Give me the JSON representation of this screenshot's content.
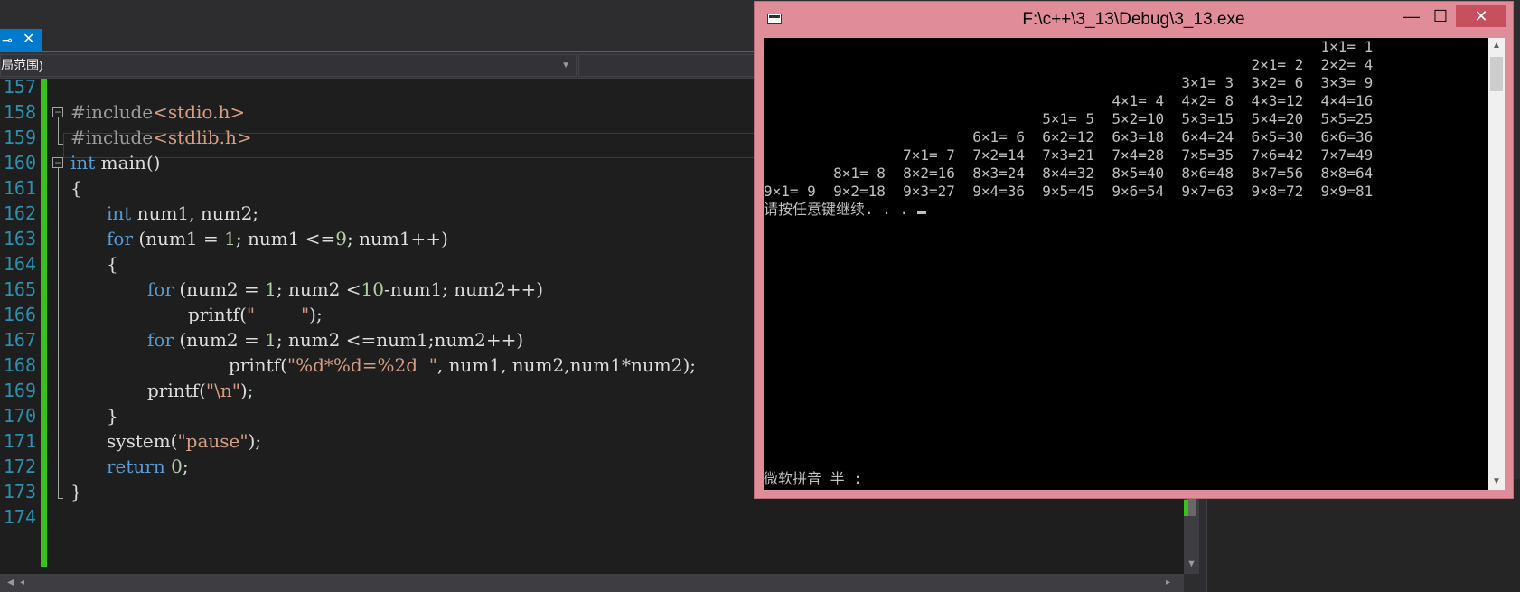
{
  "ide": {
    "tab": {
      "pin_glyph": "⊸",
      "close_glyph": "✕"
    },
    "scope_text": "局范围)",
    "line_numbers": [
      "157",
      "158",
      "159",
      "160",
      "161",
      "162",
      "163",
      "164",
      "165",
      "166",
      "167",
      "168",
      "169",
      "170",
      "171",
      "172",
      "173",
      "174"
    ],
    "code": {
      "l158": {
        "a": "#include",
        "b": "<stdio.h>"
      },
      "l159": {
        "a": "#include",
        "b": "<stdlib.h>"
      },
      "l160": {
        "a": "int",
        "b": " main()"
      },
      "l161": "{",
      "l162": {
        "a": "int",
        "b": " num1, num2;"
      },
      "l163": {
        "a": "for",
        "b": " (num1 = ",
        "c": "1",
        "d": "; num1 <=",
        "e": "9",
        "f": "; num1++)"
      },
      "l164": "{",
      "l165": {
        "a": "for",
        "b": " (num2 = ",
        "c": "1",
        "d": "; num2 <",
        "e": "10",
        "f": "-num1; num2++)"
      },
      "l166": {
        "a": "printf(",
        "b": "\"        \"",
        "c": ");"
      },
      "l167": {
        "a": "for",
        "b": " (num2 = ",
        "c": "1",
        "d": "; num2 <=num1;num2++)"
      },
      "l168": {
        "a": "printf(",
        "b": "\"%d*%d=%2d  \"",
        "c": ", num1, num2,num1*num2);"
      },
      "l169": {
        "a": "printf(",
        "b": "\"\\n\"",
        "c": ");"
      },
      "l170": "}",
      "l171": {
        "a": "system(",
        "b": "\"pause\"",
        "c": ");"
      },
      "l172": {
        "a": "return",
        "b": " ",
        "c": "0",
        "d": ";"
      },
      "l173": "}"
    }
  },
  "console": {
    "title": "F:\\c++\\3_13\\Debug\\3_13.exe",
    "min_glyph": "—",
    "max_glyph": "☐",
    "close_glyph": "✕",
    "output_lines": [
      "                                                                1×1= 1",
      "                                                        2×1= 2  2×2= 4",
      "                                                3×1= 3  3×2= 6  3×3= 9",
      "                                        4×1= 4  4×2= 8  4×3=12  4×4=16",
      "                                5×1= 5  5×2=10  5×3=15  5×4=20  5×5=25",
      "                        6×1= 6  6×2=12  6×3=18  6×4=24  6×5=30  6×6=36",
      "                7×1= 7  7×2=14  7×3=21  7×4=28  7×5=35  7×6=42  7×7=49",
      "        8×1= 8  8×2=16  8×3=24  8×4=32  8×5=40  8×6=48  8×7=56  8×8=64",
      "9×1= 9  9×2=18  9×3=27  9×4=36  9×5=45  9×6=54  9×7=63  9×8=72  9×9=81"
    ],
    "pause_prompt": "请按任意键继续. . . ",
    "ime_status": "微软拼音 半 :",
    "scroll_up_glyph": "▲",
    "scroll_down_glyph": "▼"
  },
  "colors": {
    "keyword": "#569cd6",
    "string": "#d69d85",
    "number": "#b5cea8",
    "line_number": "#2b91af",
    "change_bar": "#38c11f",
    "console_frame": "#e08c99",
    "tab_active": "#007acc"
  }
}
